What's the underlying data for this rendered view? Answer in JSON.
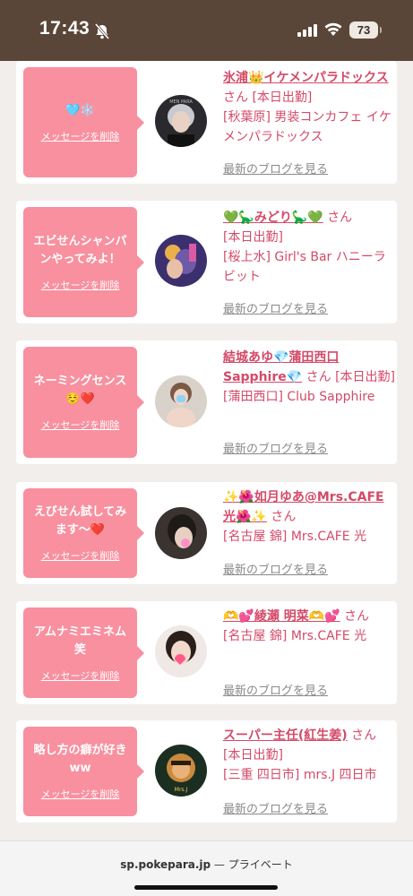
{
  "status_bar": {
    "time": "17:43",
    "battery": "73"
  },
  "messages": [
    {
      "bubble": "🩵❄️",
      "delete_label": "メッセージを削除",
      "name": "氷浦👑イケメンパラドックス",
      "suffix": "さん",
      "lines": [
        "[本日出勤]",
        "[秋葉原] 男装コンカフェ イケメンパラドックス"
      ],
      "blog_label": "最新のブログを見る"
    },
    {
      "bubble": "エビせんシャンパンやってみよ！",
      "delete_label": "メッセージを削除",
      "name": "💚🦕みどり🦕💚",
      "suffix": "さん",
      "lines": [
        "[本日出勤]",
        "[桜上水] Girl's Bar ハニーラビット"
      ],
      "blog_label": "最新のブログを見る"
    },
    {
      "bubble": "ネーミングセンス☺️❤️",
      "delete_label": "メッセージを削除",
      "name": "結城あゆ💎蒲田西口Sapphire💎",
      "suffix": "さん",
      "lines": [
        "[本日出勤]",
        "[蒲田西口] Club Sapphire"
      ],
      "blog_label": "最新のブログを見る"
    },
    {
      "bubble": "えびせん試してみます〜❤️",
      "delete_label": "メッセージを削除",
      "name": "✨🌺如月ゆあ@Mrs.CAFE光🌺✨",
      "suffix": "さん",
      "lines": [
        "[名古屋 錦] Mrs.CAFE 光"
      ],
      "blog_label": "最新のブログを見る"
    },
    {
      "bubble": "アムナミエミネム笑",
      "delete_label": "メッセージを削除",
      "name": "🫶💕綾瀬 明菜🫶💕",
      "suffix": "さん",
      "lines": [
        "[名古屋 錦] Mrs.CAFE 光"
      ],
      "blog_label": "最新のブログを見る"
    },
    {
      "bubble": "略し方の癖が好きww",
      "delete_label": "メッセージを削除",
      "name": "スーパー主任(紅生姜)",
      "suffix": "さん",
      "lines": [
        "[本日出勤]",
        "[三重 四日市] mrs.J 四日市"
      ],
      "blog_label": "最新のブログを見る"
    }
  ],
  "bottom_bar": {
    "domain": "sp.pokepara.jp",
    "separator": " — ",
    "mode": "プライベート"
  },
  "colors": {
    "accent": "#d44a68",
    "bubble": "#f8909f",
    "status_bar": "#5a4638"
  }
}
